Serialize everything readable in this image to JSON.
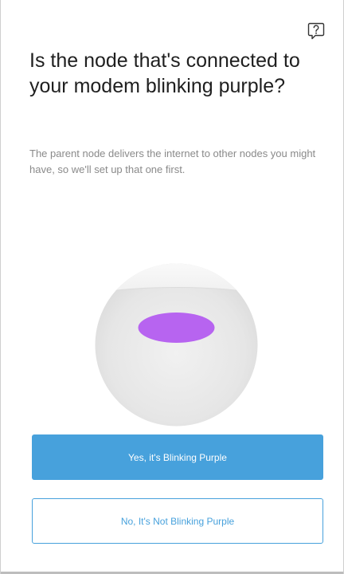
{
  "header": {
    "help_icon": "question-bubble-icon"
  },
  "content": {
    "title": "Is the node that's connected to your modem blinking purple?",
    "subtitle": "The parent node delivers the internet to other nodes you might have, so we'll set up that one first."
  },
  "illustration": {
    "icon": "node-top-light-icon",
    "light_color": "#b764f0",
    "status": "blinking purple"
  },
  "actions": {
    "yes_label": "Yes, it's Blinking Purple",
    "no_label": "No, It's Not Blinking Purple"
  },
  "colors": {
    "accent": "#47a1dc",
    "title_text": "#1f1f1f",
    "body_text": "#8a8a8a"
  }
}
